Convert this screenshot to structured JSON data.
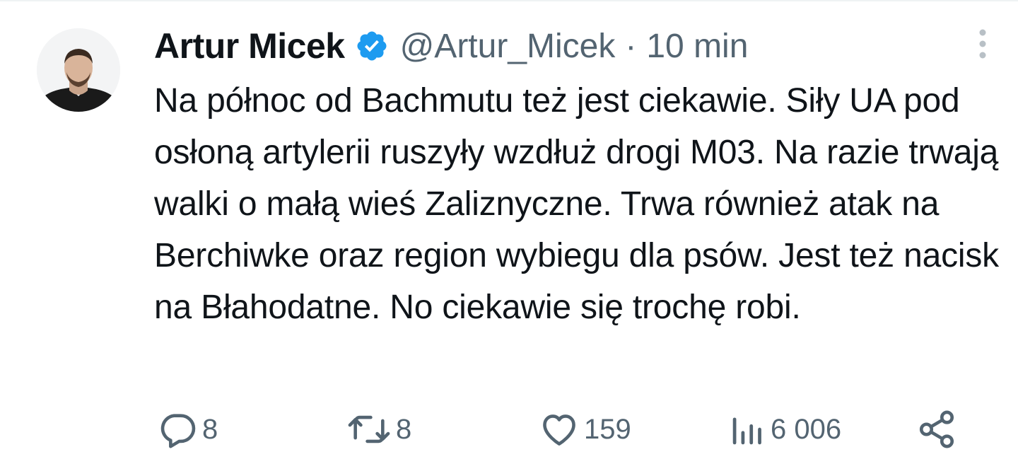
{
  "tweet": {
    "author_name": "Artur Micek",
    "handle": "@Artur_Micek",
    "separator": "·",
    "time": "10 min",
    "text": "Na północ od Bachmutu też jest ciekawie. Siły UA pod osłoną artylerii ruszyły wzdłuż drogi M03. Na razie trwają walki o małą wieś Zaliznyczne. Trwa również atak na Berchiwke oraz region wybiegu dla psów. Jest też nacisk na Błahodatne. No ciekawie się trochę robi."
  },
  "actions": {
    "reply_count": "8",
    "retweet_count": "8",
    "like_count": "159",
    "views_count": "6 006"
  },
  "icons": {
    "verified": "verified-badge-icon",
    "more": "more-vertical-icon",
    "reply": "reply-icon",
    "retweet": "retweet-icon",
    "like": "heart-icon",
    "views": "views-chart-icon",
    "share": "share-icon"
  },
  "colors": {
    "text": "#0f1419",
    "secondary": "#536471",
    "verified": "#1d9bf0",
    "background": "#ffffff"
  }
}
